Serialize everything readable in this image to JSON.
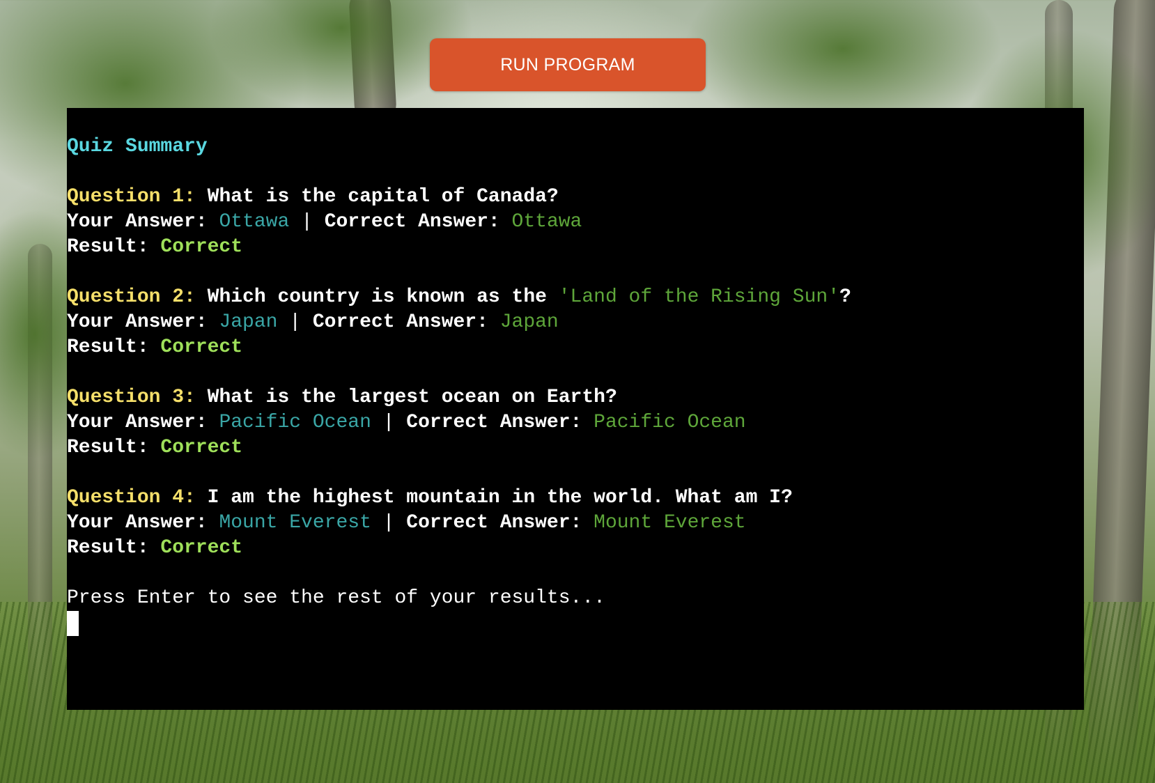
{
  "toolbar": {
    "run_label": "RUN PROGRAM"
  },
  "terminal": {
    "title": "Quiz Summary",
    "your_answer_label": "Your Answer: ",
    "separator": " | ",
    "correct_answer_label": "Correct Answer: ",
    "result_label": "Result: ",
    "questions": [
      {
        "label": "Question 1:",
        "text": " What is the capital of Canada?",
        "your_answer": "Ottawa",
        "correct_answer": "Ottawa",
        "result": "Correct"
      },
      {
        "label": "Question 2:",
        "text_before": " Which country is known as the ",
        "quote": "'Land of the Rising Sun'",
        "text_after": "?",
        "your_answer": "Japan",
        "correct_answer": "Japan",
        "result": "Correct"
      },
      {
        "label": "Question 3:",
        "text": " What is the largest ocean on Earth?",
        "your_answer": "Pacific Ocean",
        "correct_answer": "Pacific Ocean",
        "result": "Correct"
      },
      {
        "label": "Question 4:",
        "text": " I am the highest mountain in the world. What am I?",
        "your_answer": "Mount Everest",
        "correct_answer": "Mount Everest",
        "result": "Correct"
      }
    ],
    "prompt": "Press Enter to see the rest of your results..."
  },
  "colors": {
    "button": "#d9542b",
    "terminal_bg": "#000000",
    "title": "#5ad7e0",
    "question_label": "#f5df6a",
    "your_answer": "#3aa6a6",
    "correct_answer": "#5ea63a",
    "result": "#9fe05a"
  }
}
